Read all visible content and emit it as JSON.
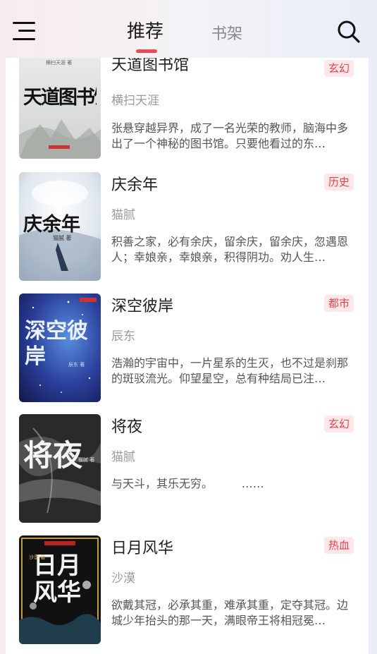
{
  "header": {
    "tabs": [
      {
        "label": "推荐",
        "active": true
      },
      {
        "label": "书架",
        "active": false
      }
    ],
    "accent_color": "#ec4a52"
  },
  "books": [
    {
      "title": "天道图书馆",
      "tag": "玄幻",
      "author": "横扫天涯",
      "description": "张悬穿越异界，成了一名光荣的教师，脑海中多出了一个神秘的图书馆。只要他看过的东…",
      "cover_text": "天道图书馆",
      "cover_author_text": "横扫天涯 著"
    },
    {
      "title": "庆余年",
      "tag": "历史",
      "author": "猫腻",
      "description": "积善之家，必有余庆，留余庆，留余庆，忽遇恩人；幸娘亲，幸娘亲，积得阴功。劝人生…",
      "cover_text": "庆余年",
      "cover_author_text": "猫腻 著"
    },
    {
      "title": "深空彼岸",
      "tag": "都市",
      "author": "辰东",
      "description": "浩瀚的宇宙中，一片星系的生灭，也不过是刹那的斑驳流光。仰望星空，总有种结局已注…",
      "cover_text": "深空彼岸",
      "cover_author_text": "辰东 著"
    },
    {
      "title": "将夜",
      "tag": "玄幻",
      "author": "猫腻",
      "description": "与天斗，其乐无穷。        ……",
      "cover_text": "将夜",
      "cover_author_text": "猫腻 著"
    },
    {
      "title": "日月风华",
      "tag": "热血",
      "author": "沙漠",
      "description": "欲戴其冠，必承其重，难承其重，定夺其冠。边城少年抬头的那一天，满眼帝王将相冠冕…",
      "cover_text": "日月风华",
      "cover_author_text": "沙漠 著"
    }
  ]
}
